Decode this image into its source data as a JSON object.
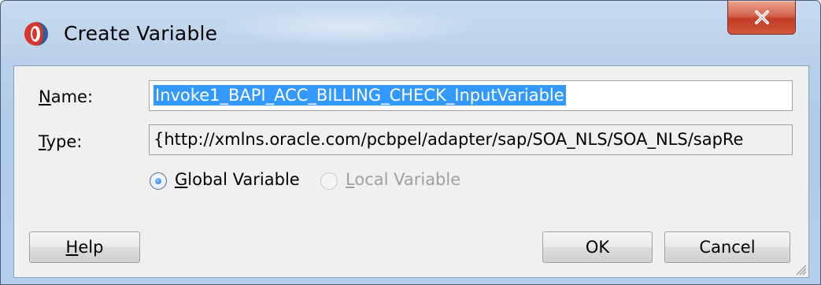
{
  "window": {
    "title": "Create Variable",
    "app_icon": "oracle-jdeveloper-icon",
    "close_icon": "close-icon"
  },
  "form": {
    "name_label_mnemonic": "N",
    "name_label_rest": "ame:",
    "name_value": "Invoke1_BAPI_ACC_BILLING_CHECK_InputVariable",
    "type_label_mnemonic": "T",
    "type_label_rest": "ype:",
    "type_value": "{http://xmlns.oracle.com/pcbpel/adapter/sap/SOA_NLS/SOA_NLS/sapRe",
    "scope": {
      "global_mnemonic": "G",
      "global_rest": "lobal Variable",
      "local_mnemonic": "L",
      "local_rest": "ocal Variable",
      "selected": "global"
    }
  },
  "buttons": {
    "help_mnemonic": "H",
    "help_rest": "elp",
    "ok": "OK",
    "cancel": "Cancel"
  },
  "colors": {
    "selection": "#3399ff",
    "close_button": "#c23c25",
    "client_bg": "#f0f0f0"
  }
}
